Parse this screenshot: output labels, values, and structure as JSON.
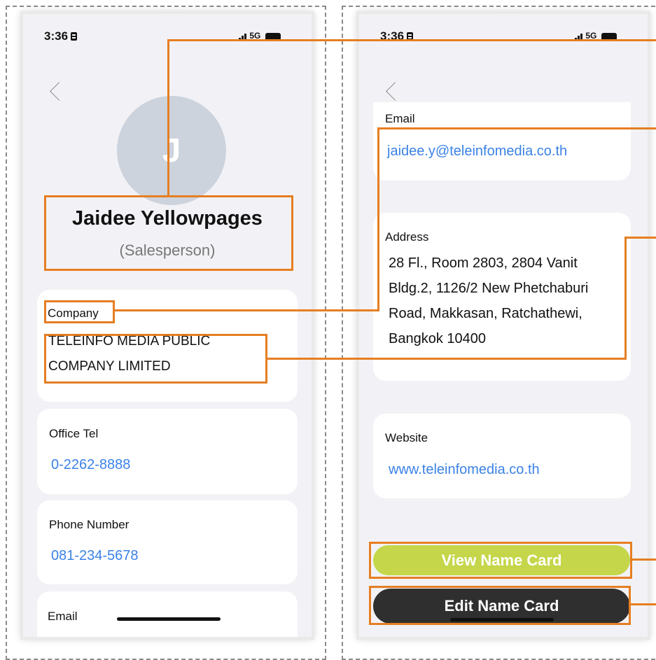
{
  "status_bar": {
    "time": "3:36",
    "network": "5G"
  },
  "left_screen": {
    "avatar_initial": "J",
    "name": "Jaidee Yellowpages",
    "role": "(Salesperson)",
    "company_label": "Company",
    "company_lines": [
      "TELEINFO MEDIA PUBLIC",
      "COMPANY LIMITED"
    ],
    "office_tel_label": "Office Tel",
    "office_tel": "0-2262-8888",
    "phone_label": "Phone Number",
    "phone": "081-234-5678",
    "email_label": "Email"
  },
  "right_screen": {
    "email_label": "Email",
    "email": "jaidee.y@teleinfomedia.co.th",
    "address_label": "Address",
    "address_lines": [
      "28 Fl., Room 2803, 2804 Vanit",
      "Bldg.2, 1126/2 New Phetchaburi",
      "Road, Makkasan, Ratchathewi,",
      "Bangkok 10400"
    ],
    "website_label": "Website",
    "website": "www.teleinfomedia.co.th",
    "view_button": "View Name Card",
    "edit_button": "Edit Name Card"
  },
  "colors": {
    "highlight": "#e67e22",
    "link": "#3b82e6",
    "view_button": "#c5d64a",
    "edit_button": "#2f2f2f"
  }
}
